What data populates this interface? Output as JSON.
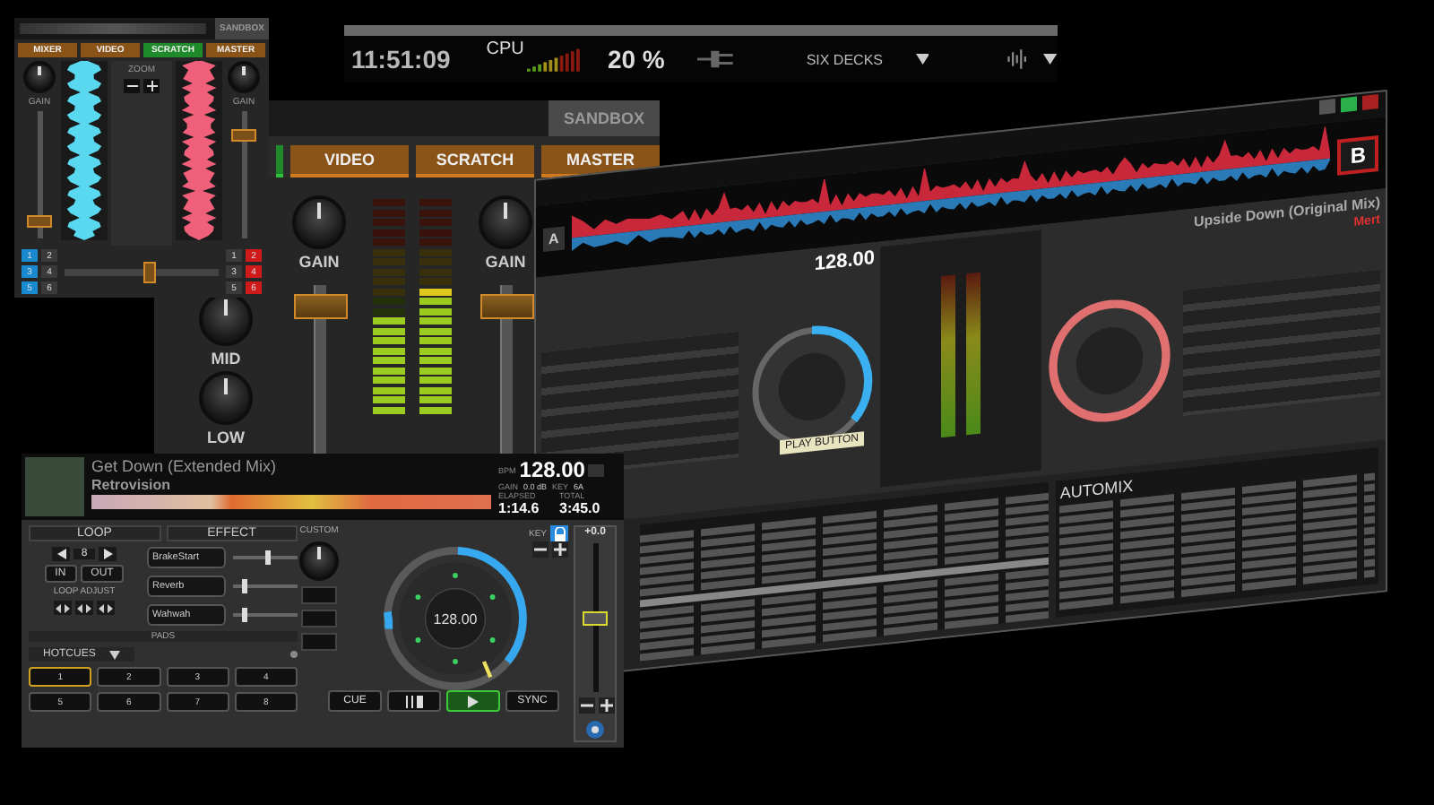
{
  "top_bar": {
    "clock": "11:51:09",
    "cpu_label": "CPU",
    "cpu_percent": "20 %",
    "layout_label": "SIX DECKS"
  },
  "mixer_panel": {
    "sandbox": "SANDBOX",
    "tabs": [
      {
        "selected": true
      },
      {
        "label": "VIDEO",
        "selected": false
      },
      {
        "label": "SCRATCH",
        "selected": false
      },
      {
        "label": "MASTER",
        "selected": false
      }
    ],
    "gain_labels": [
      "GAIN",
      "GAIN"
    ],
    "eq_labels": [
      "MID",
      "LOW"
    ],
    "faders": [
      {
        "level": 0.95
      },
      {
        "level": 0.95
      }
    ],
    "meters": [
      {
        "level": 0.45
      },
      {
        "level": 0.55
      }
    ]
  },
  "mini_mixer": {
    "sandbox": "SANDBOX",
    "tabs": [
      {
        "label": "MIXER",
        "selected": false
      },
      {
        "label": "VIDEO",
        "selected": false
      },
      {
        "label": "SCRATCH",
        "selected": true
      },
      {
        "label": "MASTER",
        "selected": false
      }
    ],
    "zoom": "ZOOM",
    "gain_labels": [
      "GAIN",
      "GAIN"
    ],
    "faders": [
      {
        "level": 0.1
      },
      {
        "level": 0.9
      }
    ],
    "crossfader": {
      "level": 0.55
    },
    "left_decks": [
      {
        "label": "1",
        "selected": true
      },
      {
        "label": "2",
        "selected": false
      },
      {
        "label": "3",
        "selected": true
      },
      {
        "label": "4",
        "selected": false
      },
      {
        "label": "5",
        "selected": true
      },
      {
        "label": "6",
        "selected": false
      }
    ],
    "right_decks": [
      {
        "label": "1",
        "selected": false
      },
      {
        "label": "2",
        "selected": true
      },
      {
        "label": "3",
        "selected": false
      },
      {
        "label": "4",
        "selected": true
      },
      {
        "label": "5",
        "selected": false
      },
      {
        "label": "6",
        "selected": true
      }
    ]
  },
  "main_window": {
    "logo": "B",
    "deck_letter": "A",
    "deck_a_bpm": "128.00",
    "deck_b_title": "Upside Down (Original Mix)",
    "deck_b_artist": "Mert",
    "tooltip": "PLAY BUTTON",
    "automix": "AUTOMIX"
  },
  "deck": {
    "title": "Get Down (Extended Mix)",
    "artist": "Retrovision",
    "bpm_label": "BPM",
    "bpm": "128.00",
    "gain_label": "GAIN",
    "gain": "0.0 dB",
    "key_label": "KEY",
    "key": "6A",
    "elapsed_label": "ELAPSED",
    "elapsed": "1:14.6",
    "total_label": "TOTAL",
    "total": "3:45.0",
    "loop_tab": "LOOP",
    "effect_tab": "EFFECT",
    "loop_size": "8",
    "loop_in": "IN",
    "loop_out": "OUT",
    "loop_adjust": "LOOP ADJUST",
    "effects": [
      {
        "name": "BrakeStart",
        "level": 0.6
      },
      {
        "name": "Reverb",
        "level": 0.15
      },
      {
        "name": "Wahwah",
        "level": 0.15
      }
    ],
    "pads_label": "PADS",
    "hotcues": "HOTCUES",
    "pads": [
      {
        "label": "1",
        "selected": true
      },
      {
        "label": "2",
        "selected": false
      },
      {
        "label": "3",
        "selected": false
      },
      {
        "label": "4",
        "selected": false
      },
      {
        "label": "5",
        "selected": false
      },
      {
        "label": "6",
        "selected": false
      },
      {
        "label": "7",
        "selected": false
      },
      {
        "label": "8",
        "selected": false
      }
    ],
    "custom_label": "CUSTOM",
    "key_lock_label": "KEY",
    "key_lock": true,
    "jog_bpm": "128.00",
    "pitch": "+0.0",
    "pitch_slider": {
      "level": 0.5
    },
    "cue": "CUE",
    "sync": "SYNC",
    "playing": true
  }
}
